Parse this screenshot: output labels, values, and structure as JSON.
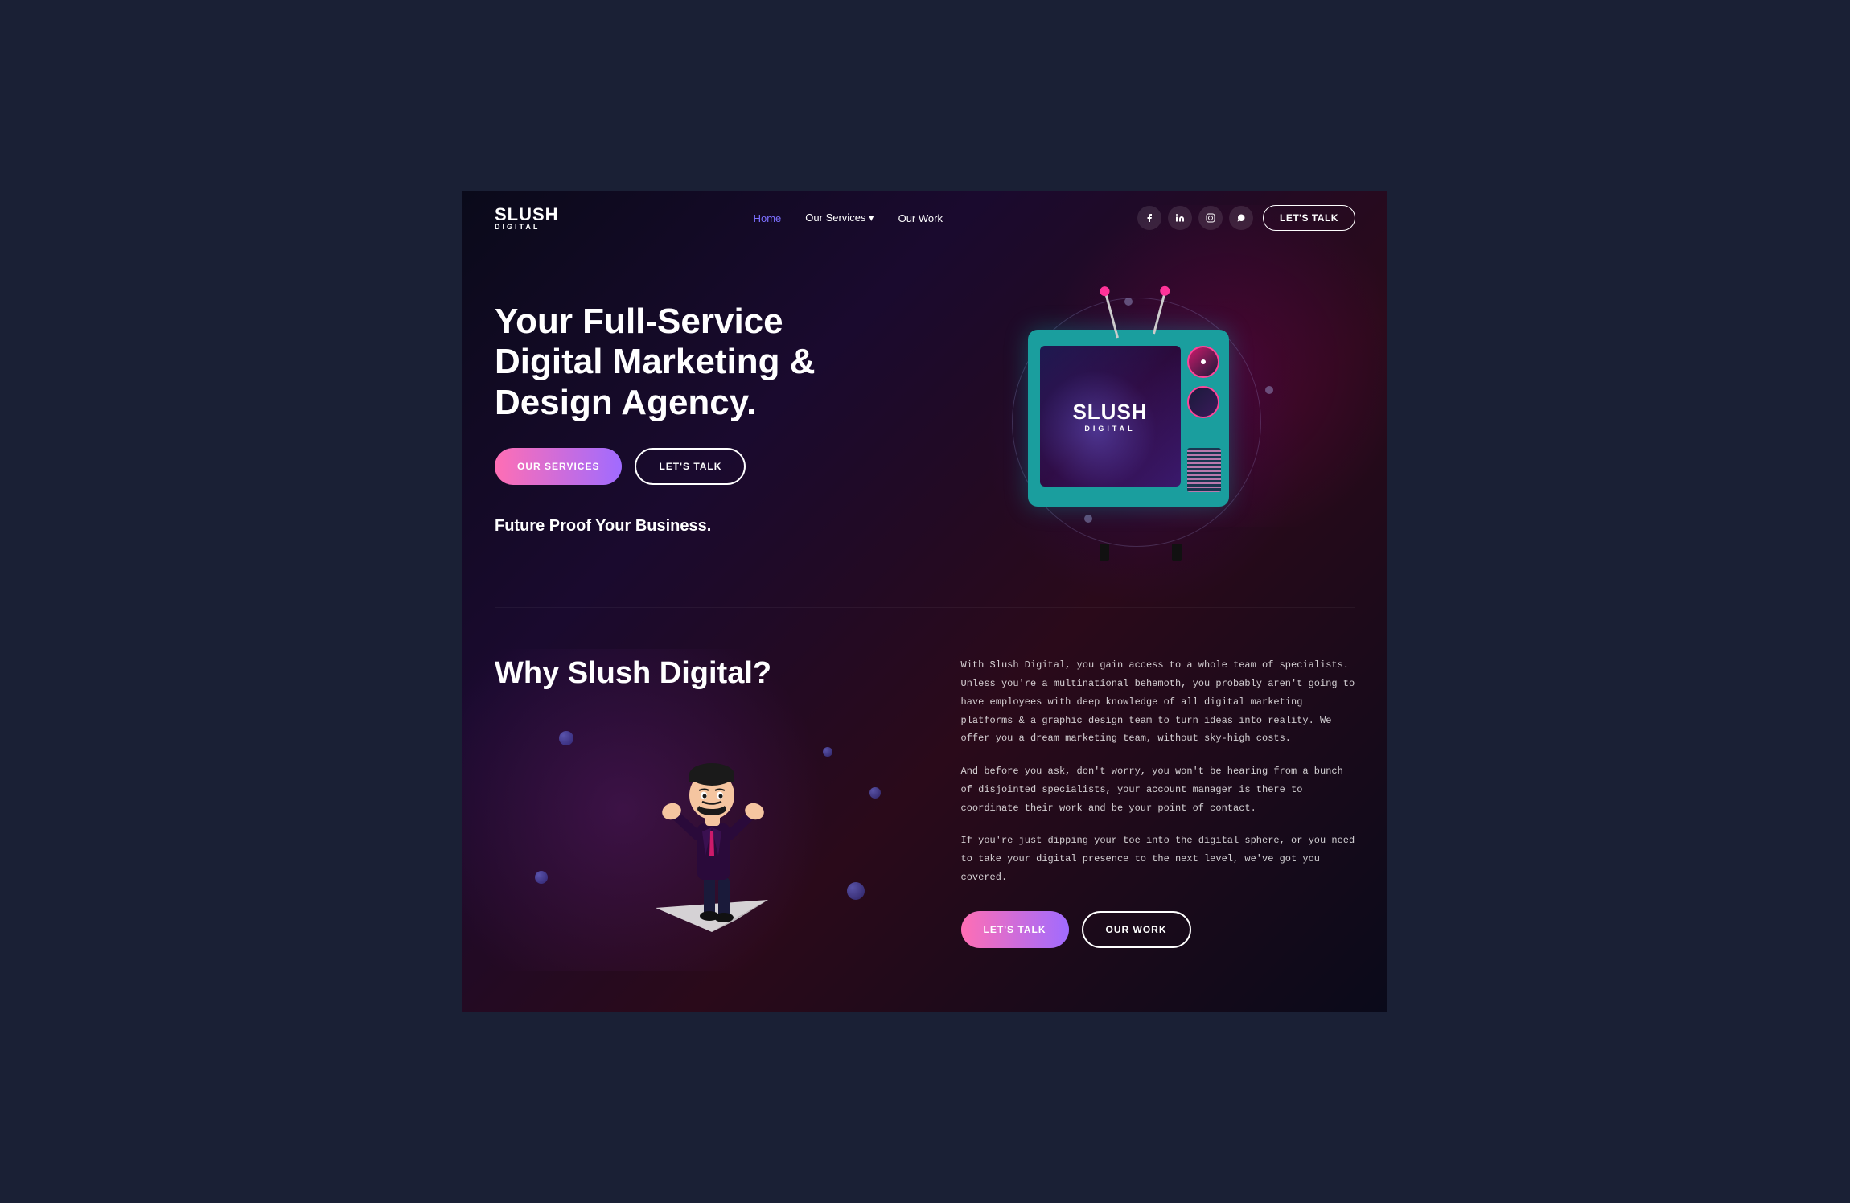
{
  "page": {
    "bg_color": "#1a2035"
  },
  "navbar": {
    "logo": {
      "slush": "SLUSH",
      "digital": "DIGITAL"
    },
    "links": [
      {
        "id": "home",
        "label": "Home",
        "active": true
      },
      {
        "id": "our-services",
        "label": "Our Services ▾",
        "active": false
      },
      {
        "id": "our-work",
        "label": "Our Work",
        "active": false
      }
    ],
    "social": [
      {
        "id": "facebook",
        "icon": "f",
        "label": "Facebook"
      },
      {
        "id": "linkedin",
        "icon": "in",
        "label": "LinkedIn"
      },
      {
        "id": "instagram",
        "icon": "ig",
        "label": "Instagram"
      },
      {
        "id": "whatsapp",
        "icon": "w",
        "label": "WhatsApp"
      }
    ],
    "cta": "LET'S TALK"
  },
  "hero": {
    "title": "Your Full-Service Digital Marketing & Design Agency.",
    "btn_services": "OUR SERVICES",
    "btn_talk": "LET'S TALK",
    "tagline": "Future Proof Your Business.",
    "tv_slush": "SLUSH",
    "tv_digital": "DIGITAL"
  },
  "why": {
    "title": "Why Slush Digital?",
    "paragraph1": "With Slush Digital, you gain access to a whole team of specialists. Unless you're a multinational behemoth, you probably aren't going to have employees with deep knowledge of all digital marketing platforms & a graphic design team to turn ideas into reality. We offer you a dream marketing team, without sky-high costs.",
    "paragraph2": "And before you ask, don't worry, you won't be hearing from a bunch of disjointed specialists, your account manager is there to coordinate their work and be your point of contact.",
    "paragraph3": "If you're just dipping your toe into the digital sphere, or you need to take your digital presence to the next level, we've got you covered.",
    "btn_talk": "LET'S TALK",
    "btn_work": "OUR WORK"
  }
}
